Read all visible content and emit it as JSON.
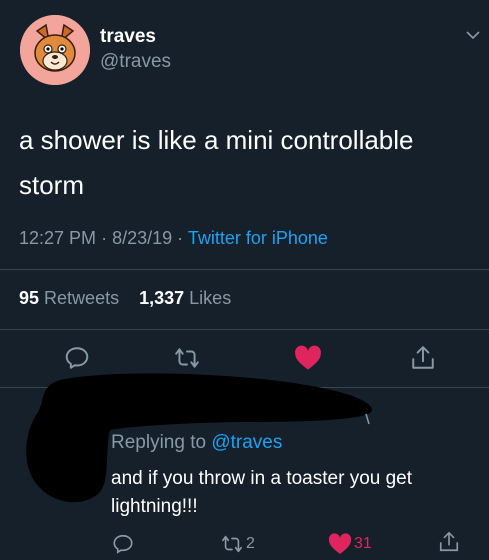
{
  "tweet": {
    "display_name": "traves",
    "handle": "@traves",
    "text": "a shower is like a mini controllable storm",
    "time": "12:27 PM",
    "date": "8/23/19",
    "source": "Twitter for iPhone",
    "retweets_count": "95",
    "retweets_label": "Retweets",
    "likes_count": "1,337",
    "likes_label": "Likes",
    "liked": true
  },
  "reply": {
    "replying_prefix": "Replying to ",
    "replying_to": "@traves",
    "text": "and if you throw in a toaster you get lightning!!!",
    "retweets_count": "2",
    "likes_count": "31",
    "liked": true
  },
  "colors": {
    "background": "#15202b",
    "accent": "#1da1f2",
    "like": "#e0245e",
    "secondary_text": "#8899a6",
    "divider": "#38444d"
  },
  "icons": [
    "avatar-dog",
    "chevron-down",
    "reply",
    "retweet",
    "heart-filled",
    "share"
  ]
}
